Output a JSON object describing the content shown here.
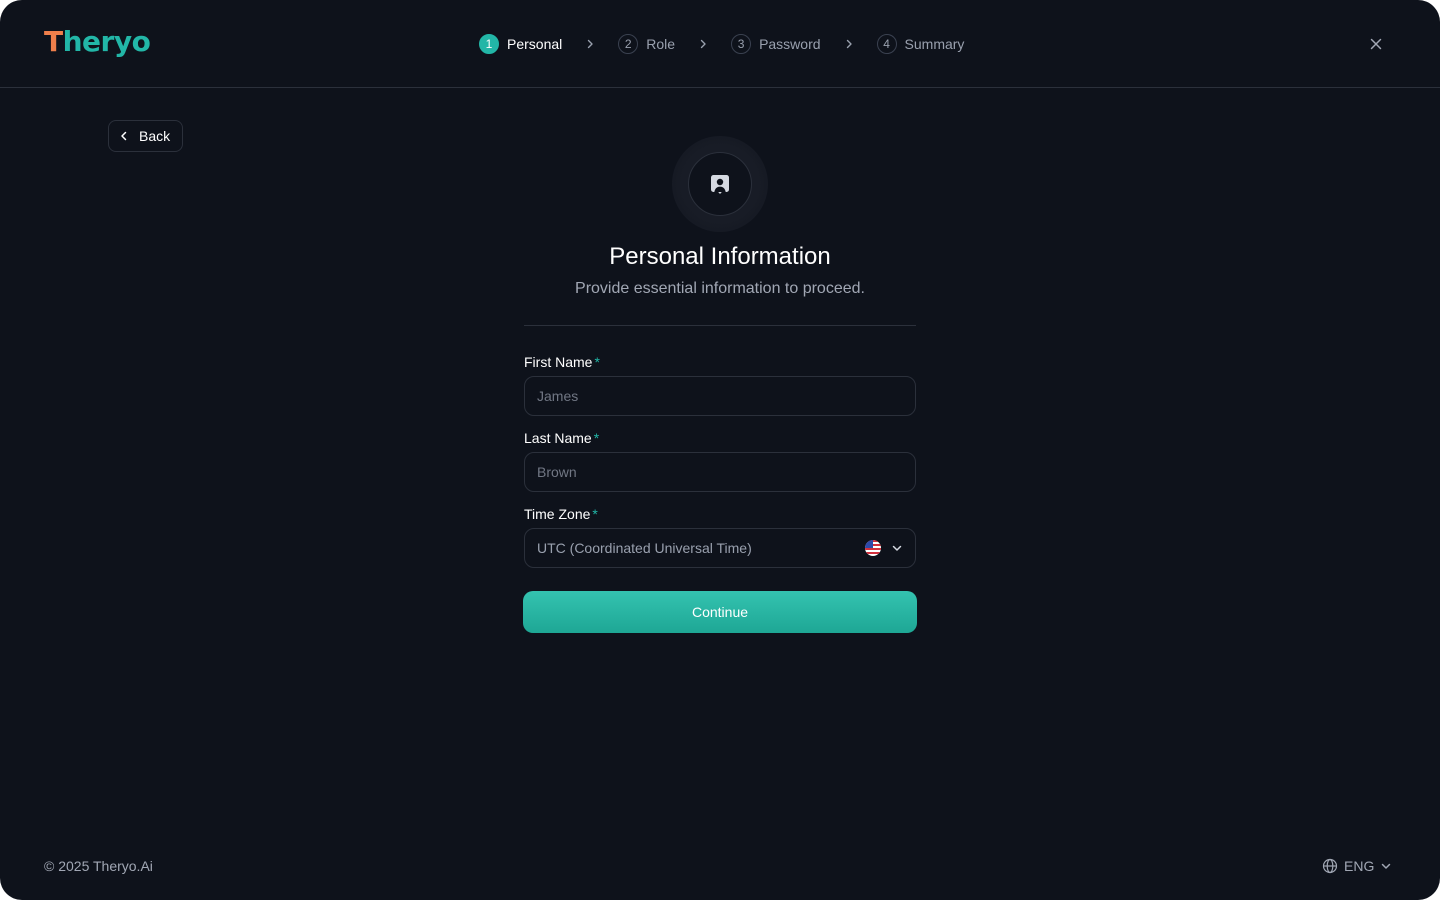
{
  "brand": {
    "logo_first": "T",
    "logo_rest": "heryo"
  },
  "steps": [
    {
      "num": "1",
      "label": "Personal",
      "active": true
    },
    {
      "num": "2",
      "label": "Role",
      "active": false
    },
    {
      "num": "3",
      "label": "Password",
      "active": false
    },
    {
      "num": "4",
      "label": "Summary",
      "active": false
    }
  ],
  "back_label": "Back",
  "hero": {
    "icon": "user-square-icon",
    "title": "Personal Information",
    "subtitle": "Provide essential information to proceed."
  },
  "form": {
    "first_name": {
      "label": "First Name",
      "required_mark": "*",
      "placeholder": "James",
      "value": ""
    },
    "last_name": {
      "label": "Last Name",
      "required_mark": "*",
      "placeholder": "Brown",
      "value": ""
    },
    "time_zone": {
      "label": "Time Zone",
      "required_mark": "*",
      "value": "UTC (Coordinated Universal Time)",
      "flag_icon": "us-flag-icon"
    },
    "continue_label": "Continue"
  },
  "footer": {
    "copyright": "© 2025 Theryo.Ai",
    "language": "ENG"
  },
  "colors": {
    "background": "#0e121b",
    "accent": "#22b6a7",
    "logo_accent": "#ef7f4b",
    "border": "#2b303b",
    "muted_text": "#99a0ae"
  }
}
